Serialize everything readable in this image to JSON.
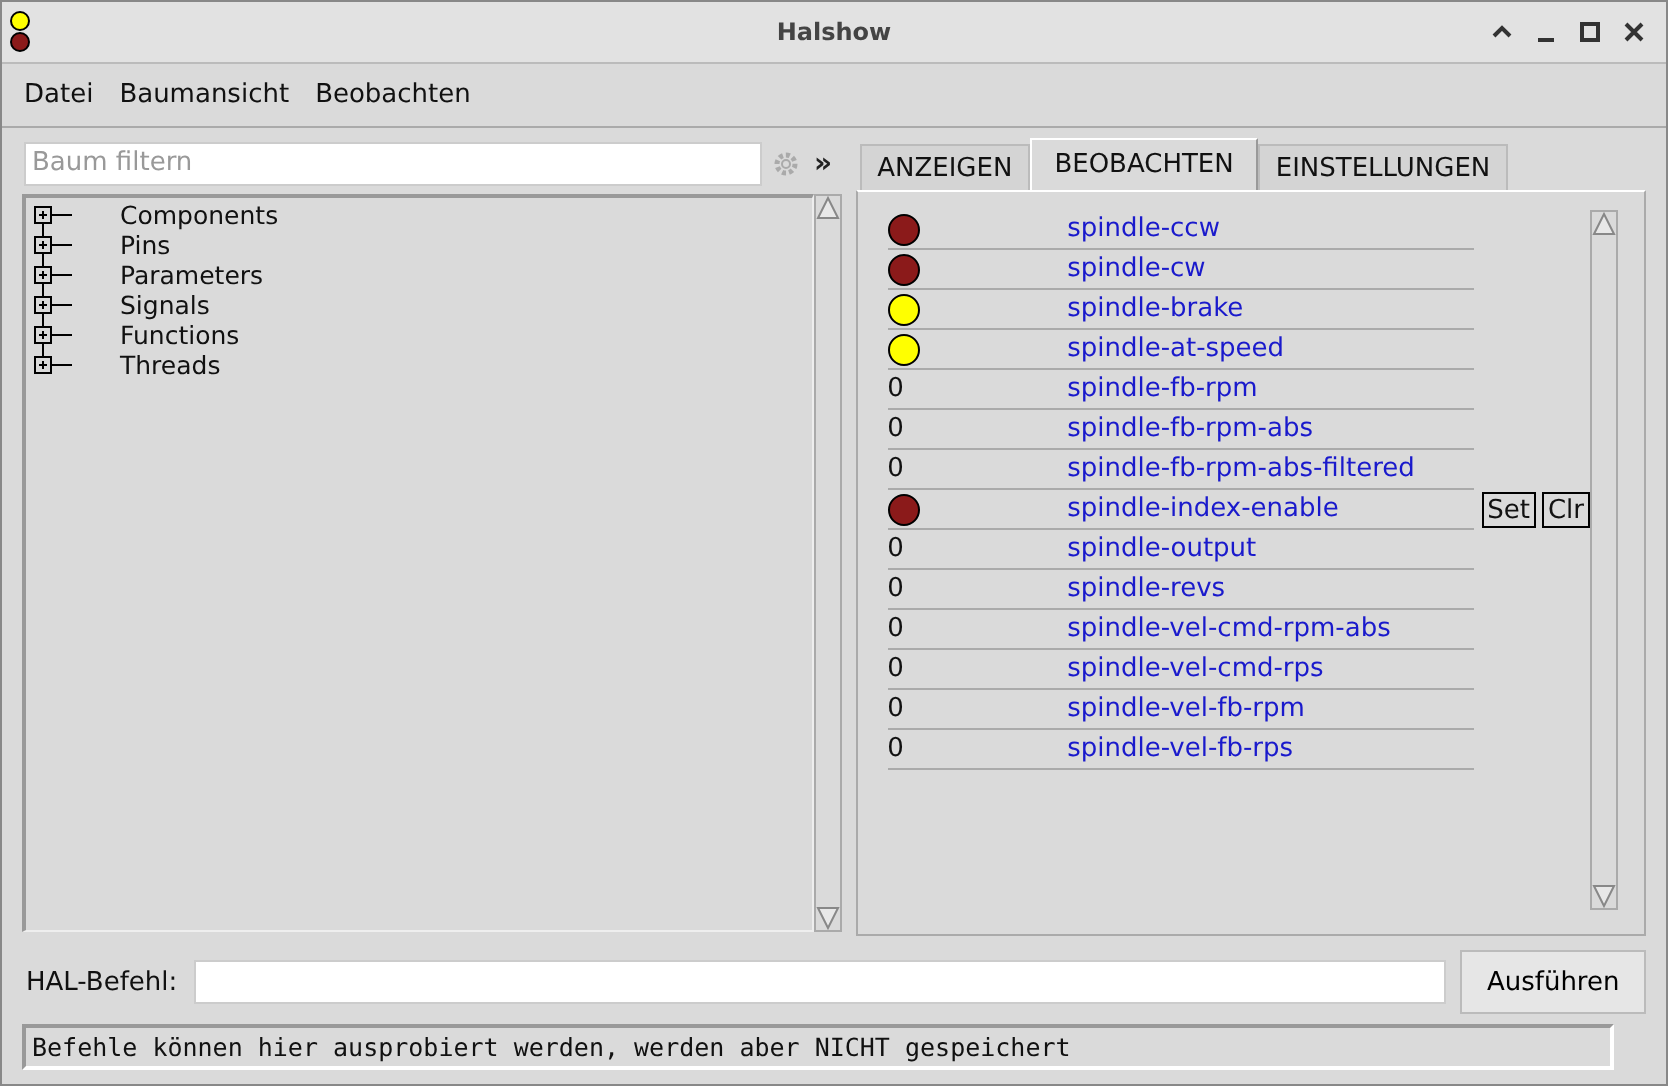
{
  "window": {
    "title": "Halshow"
  },
  "menu": [
    "Datei",
    "Baumansicht",
    "Beobachten"
  ],
  "filter": {
    "placeholder": "Baum filtern",
    "expand_label": "»"
  },
  "tree": [
    {
      "label": "Components",
      "expanded": false
    },
    {
      "label": "Pins",
      "expanded": false
    },
    {
      "label": "Parameters",
      "expanded": false
    },
    {
      "label": "Signals",
      "expanded": false
    },
    {
      "label": "Functions",
      "expanded": false
    },
    {
      "label": "Threads",
      "expanded": false
    }
  ],
  "tabs": [
    {
      "label": "ANZEIGEN",
      "selected": false
    },
    {
      "label": "BEOBACHTEN",
      "selected": true
    },
    {
      "label": "EINSTELLUNGEN",
      "selected": false
    }
  ],
  "watch": [
    {
      "kind": "led",
      "on": false,
      "name": "spindle-ccw"
    },
    {
      "kind": "led",
      "on": false,
      "name": "spindle-cw"
    },
    {
      "kind": "led",
      "on": true,
      "name": "spindle-brake"
    },
    {
      "kind": "led",
      "on": true,
      "name": "spindle-at-speed"
    },
    {
      "kind": "value",
      "value": "0",
      "name": "spindle-fb-rpm"
    },
    {
      "kind": "value",
      "value": "0",
      "name": "spindle-fb-rpm-abs"
    },
    {
      "kind": "value",
      "value": "0",
      "name": "spindle-fb-rpm-abs-filtered"
    },
    {
      "kind": "led",
      "on": false,
      "name": "spindle-index-enable",
      "buttons": [
        "Set",
        "Clr"
      ]
    },
    {
      "kind": "value",
      "value": "0",
      "name": "spindle-output"
    },
    {
      "kind": "value",
      "value": "0",
      "name": "spindle-revs"
    },
    {
      "kind": "value",
      "value": "0",
      "name": "spindle-vel-cmd-rpm-abs"
    },
    {
      "kind": "value",
      "value": "0",
      "name": "spindle-vel-cmd-rps"
    },
    {
      "kind": "value",
      "value": "0",
      "name": "spindle-vel-fb-rpm"
    },
    {
      "kind": "value",
      "value": "0",
      "name": "spindle-vel-fb-rps"
    }
  ],
  "command": {
    "label": "HAL-Befehl:",
    "button": "Ausführen"
  },
  "status_bar": "Befehle können hier ausprobiert werden, werden aber NICHT gespeichert"
}
